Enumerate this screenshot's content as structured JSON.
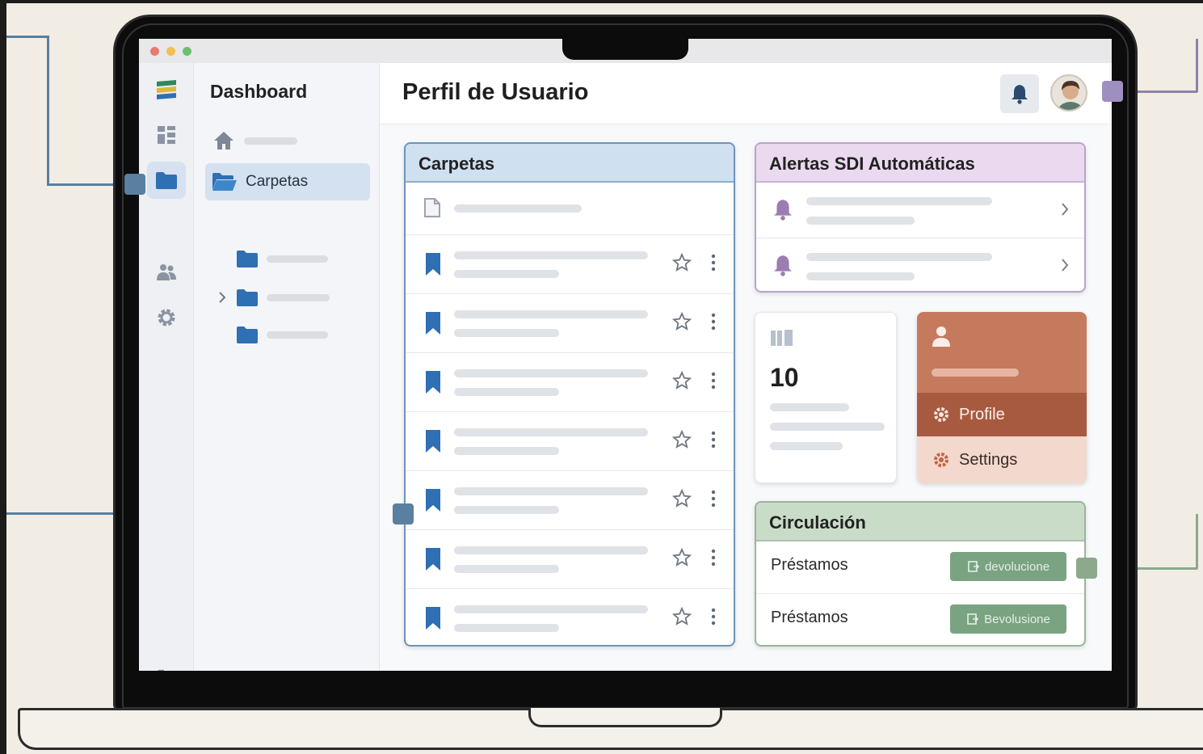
{
  "sidebar": {
    "title": "Dashboard",
    "nav": [
      {
        "icon": "home-icon",
        "label": ""
      },
      {
        "icon": "folder-open-icon",
        "label": "Carpetas"
      },
      {
        "icon": "folder-icon",
        "label": ""
      },
      {
        "icon": "folder-icon",
        "label": ""
      },
      {
        "icon": "folder-icon",
        "label": ""
      }
    ]
  },
  "rail": {
    "icons": [
      "logo-icon",
      "grid-icon",
      "folder-icon",
      "users-icon",
      "gear-icon",
      "logout-icon"
    ],
    "active": "folder-icon"
  },
  "header": {
    "title": "Perfil de Usuario",
    "notification_icon": "bell-icon",
    "avatar_icon": "avatar-icon"
  },
  "folders_card": {
    "title": "Carpetas",
    "rows": 8
  },
  "alerts_card": {
    "title": "Alertas SDI Automáticas",
    "items": 2
  },
  "stat_card": {
    "value": "10"
  },
  "user_menu": {
    "items": [
      {
        "icon": "profile-icon",
        "label": "Profile"
      },
      {
        "icon": "gear-icon",
        "label": "Settings"
      }
    ]
  },
  "circulation_card": {
    "title": "Circulación",
    "rows": [
      {
        "label": "Préstamos",
        "button": "devolucione"
      },
      {
        "label": "Préstamos",
        "button": "Bevolusione"
      }
    ]
  },
  "colors": {
    "blue": "#2f6fb3",
    "folders_header": "#cfe0f1",
    "alerts_header": "#ead9ef",
    "alert_purple": "#9b7db1",
    "menu_orange": "#c57a5e",
    "menu_dark": "#a85a40",
    "menu_light": "#f2d8cd",
    "circ_header": "#c9dcc8",
    "circ_button": "#7aa381"
  }
}
